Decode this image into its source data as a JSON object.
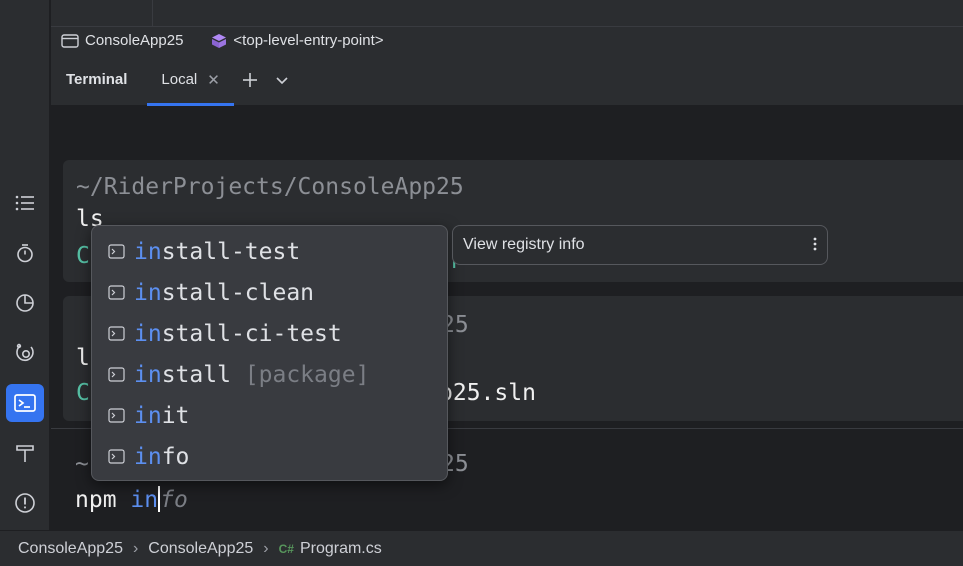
{
  "navbar": {
    "project": "ConsoleApp25",
    "entry": "<top-level-entry-point>"
  },
  "terminal": {
    "title": "Terminal",
    "tabs": [
      {
        "label": "Local",
        "active": true
      }
    ]
  },
  "blocks": [
    {
      "path": "~/RiderProjects/ConsoleApp25",
      "command": "ls",
      "output_start": "C",
      "output_end": "p"
    },
    {
      "path_end": "25",
      "command_start": "l",
      "output_start": "C",
      "output_end": "p25.sln"
    }
  ],
  "prompt": {
    "path_start": "~",
    "path_end": "25",
    "command": "npm ",
    "typed": "in",
    "ghost": "fo"
  },
  "completion": {
    "items": [
      {
        "match": "in",
        "rest": "stall-test",
        "hint": ""
      },
      {
        "match": "in",
        "rest": "stall-clean",
        "hint": ""
      },
      {
        "match": "in",
        "rest": "stall-ci-test",
        "hint": ""
      },
      {
        "match": "in",
        "rest": "stall ",
        "hint": "[package]"
      },
      {
        "match": "in",
        "rest": "it",
        "hint": ""
      },
      {
        "match": "in",
        "rest": "fo",
        "hint": ""
      }
    ],
    "doc": "View registry info"
  },
  "statusbar": {
    "crumbs": [
      "ConsoleApp25",
      "ConsoleApp25"
    ],
    "file_lang": "C#",
    "file": "Program.cs"
  },
  "colors": {
    "accent": "#3574f0",
    "match": "#5c8ff0",
    "teal": "#56c0a5"
  },
  "icons": [
    "list-icon",
    "stopwatch-icon",
    "pie-chart-icon",
    "debug-icon",
    "terminal-icon",
    "hammer-icon",
    "problems-icon",
    "console-app-icon",
    "entry-point-icon",
    "plus-icon",
    "chevron-down-icon",
    "close-icon",
    "more-vertical-icon",
    "terminal-command-icon"
  ]
}
